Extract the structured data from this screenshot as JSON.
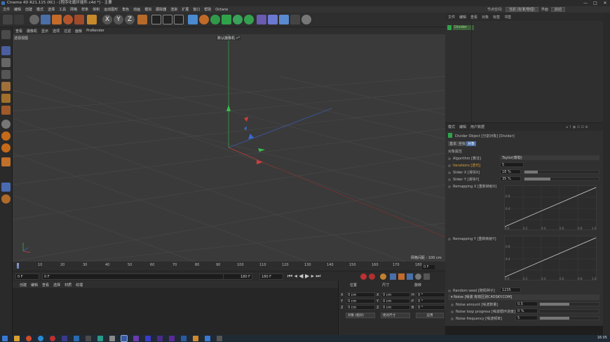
{
  "window": {
    "title": "Cinema 4D R21.115 (RC) - [程序化循环插件.c4d *] - 主要",
    "controls": [
      "—",
      "□",
      "✕"
    ]
  },
  "menu": {
    "items": [
      "文件",
      "编辑",
      "创建",
      "模式",
      "选择",
      "工具",
      "网格",
      "样条",
      "体积",
      "运动图形",
      "角色",
      "动画",
      "模拟",
      "跟踪器",
      "渲染",
      "扩展",
      "窗口",
      "帮助",
      "Octane"
    ]
  },
  "right_menu": {
    "node_space_label": "节点空间:",
    "node_space_value": "当前 (标准/物理)",
    "layout_label": "界面",
    "layout_value": "启动"
  },
  "viewport": {
    "menu": [
      "查看",
      "摄像机",
      "显示",
      "选项",
      "过滤",
      "面板",
      "ProRender"
    ],
    "view_name": "透视视图",
    "camera_label": "默认摄像机 •°",
    "grid_spacing": "网格间距 : 100 cm"
  },
  "timeline": {
    "ticks": [
      "0",
      "10",
      "20",
      "30",
      "40",
      "50",
      "60",
      "70",
      "80",
      "90",
      "100",
      "110",
      "120",
      "130",
      "140",
      "150",
      "160",
      "170",
      "180"
    ],
    "frame_indicator": "0 F"
  },
  "transport": {
    "start": "0 F",
    "current": "0 F",
    "end_a": "180 F",
    "end_b": "180 F"
  },
  "materials": {
    "menu": [
      "创建",
      "编辑",
      "查看",
      "选择",
      "材质",
      "纹理"
    ]
  },
  "coords": {
    "headers": {
      "position": "位置",
      "size": "尺寸",
      "rotation": "旋转"
    },
    "rows": [
      {
        "axis": "X",
        "pos": "0 cm",
        "size_axis": "X",
        "size": "0 cm",
        "rot_axis": "H",
        "rot": "0 °"
      },
      {
        "axis": "Y",
        "pos": "0 cm",
        "size_axis": "Y",
        "size": "0 cm",
        "rot_axis": "P",
        "rot": "0 °"
      },
      {
        "axis": "Z",
        "pos": "0 cm",
        "size_axis": "Z",
        "size": "0 cm",
        "rot_axis": "B",
        "rot": "0 °"
      }
    ],
    "mode_dropdown": "对象 (相对)",
    "size_dropdown": "绝对尺寸",
    "apply_button": "应用"
  },
  "object_manager": {
    "tabs": [
      "文件",
      "编辑",
      "查看",
      "对象",
      "标签",
      "书签"
    ],
    "object_name": "Divider"
  },
  "attributes": {
    "tabs": [
      "模式",
      "编辑",
      "用户数据"
    ],
    "object_title": "Divider Object [分割对象] [Divider]",
    "sub_tabs": [
      "基本",
      "坐标",
      "对象"
    ],
    "section": "对象属性",
    "algorithm_label": "Algorithm [算法]",
    "algorithm_value": "Taylor(泰勒)",
    "iterations_label": "Iterations [迭代]",
    "iterations_value": "5",
    "slider_x_label": "Slider X [滑块X]",
    "slider_x_value": "18 %",
    "slider_x_fraction": 0.18,
    "slider_y_label": "Slider Y [滑块Y]",
    "slider_y_value": "35 %",
    "slider_y_fraction": 0.35,
    "remap_x_label": "Remapping X [重新映射X]",
    "remap_y_label": "Remapping Y [重新映射Y]",
    "graph_y_ticks": [
      "0.8",
      "0.4"
    ],
    "graph_x_ticks": [
      "0.0",
      "0.2",
      "0.4",
      "0.6",
      "0.8",
      "1.0"
    ],
    "random_seed_label": "Random seed [随机种子]",
    "random_seed_value": "1235",
    "noise_section": "Noise [噪波 有效区别C4DSKY.COM]",
    "noise_amount_label": "Noise amount [噪波数量]",
    "noise_amount_value": "0.5",
    "noise_amount_fraction": 0.5,
    "noise_loop_label": "Noise loop progress [噪波循环进度]",
    "noise_loop_value": "0 %",
    "noise_loop_fraction": 0.0,
    "noise_freq_label": "Noise frequency [噪波频率]",
    "noise_freq_value": "5",
    "noise_freq_fraction": 0.5
  },
  "taskbar": {
    "time": "16:05"
  }
}
